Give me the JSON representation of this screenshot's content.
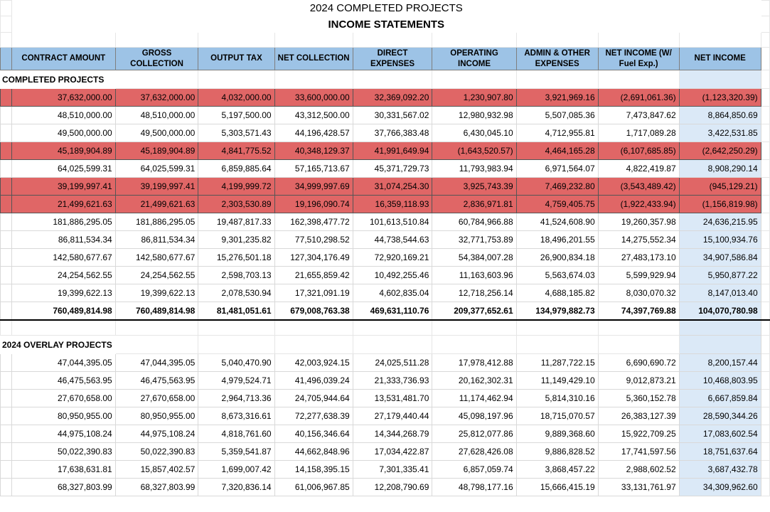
{
  "sheet": {
    "title": "2024 COMPLETED PROJECTS",
    "subtitle": "INCOME STATEMENTS"
  },
  "headers": [
    "CONTRACT AMOUNT",
    "GROSS COLLECTION",
    "OUTPUT TAX",
    "NET COLLECTION",
    "DIRECT EXPENSES",
    "OPERATING INCOME",
    "ADMIN & OTHER EXPENSES",
    "NET INCOME (W/ Fuel Exp.)",
    "NET INCOME"
  ],
  "completed": {
    "label": "COMPLETED PROJECTS",
    "rows": [
      {
        "highlight": true,
        "cells": [
          "37,632,000.00",
          "37,632,000.00",
          "4,032,000.00",
          "33,600,000.00",
          "32,369,092.20",
          "1,230,907.80",
          "3,921,969.16",
          "(2,691,061.36)",
          "(1,123,320.39)"
        ]
      },
      {
        "highlight": false,
        "cells": [
          "48,510,000.00",
          "48,510,000.00",
          "5,197,500.00",
          "43,312,500.00",
          "30,331,567.02",
          "12,980,932.98",
          "5,507,085.36",
          "7,473,847.62",
          "8,864,850.69"
        ]
      },
      {
        "highlight": false,
        "cells": [
          "49,500,000.00",
          "49,500,000.00",
          "5,303,571.43",
          "44,196,428.57",
          "37,766,383.48",
          "6,430,045.10",
          "4,712,955.81",
          "1,717,089.28",
          "3,422,531.85"
        ]
      },
      {
        "highlight": true,
        "cells": [
          "45,189,904.89",
          "45,189,904.89",
          "4,841,775.52",
          "40,348,129.37",
          "41,991,649.94",
          "(1,643,520.57)",
          "4,464,165.28",
          "(6,107,685.85)",
          "(2,642,250.29)"
        ]
      },
      {
        "highlight": false,
        "cells": [
          "64,025,599.31",
          "64,025,599.31",
          "6,859,885.64",
          "57,165,713.67",
          "45,371,729.73",
          "11,793,983.94",
          "6,971,564.07",
          "4,822,419.87",
          "8,908,290.14"
        ]
      },
      {
        "highlight": true,
        "cells": [
          "39,199,997.41",
          "39,199,997.41",
          "4,199,999.72",
          "34,999,997.69",
          "31,074,254.30",
          "3,925,743.39",
          "7,469,232.80",
          "(3,543,489.42)",
          "(945,129.21)"
        ]
      },
      {
        "highlight": true,
        "cells": [
          "21,499,621.63",
          "21,499,621.63",
          "2,303,530.89",
          "19,196,090.74",
          "16,359,118.93",
          "2,836,971.81",
          "4,759,405.75",
          "(1,922,433.94)",
          "(1,156,819.98)"
        ]
      },
      {
        "highlight": false,
        "cells": [
          "181,886,295.05",
          "181,886,295.05",
          "19,487,817.33",
          "162,398,477.72",
          "101,613,510.84",
          "60,784,966.88",
          "41,524,608.90",
          "19,260,357.98",
          "24,636,215.95"
        ]
      },
      {
        "highlight": false,
        "cells": [
          "86,811,534.34",
          "86,811,534.34",
          "9,301,235.82",
          "77,510,298.52",
          "44,738,544.63",
          "32,771,753.89",
          "18,496,201.55",
          "14,275,552.34",
          "15,100,934.76"
        ]
      },
      {
        "highlight": false,
        "cells": [
          "142,580,677.67",
          "142,580,677.67",
          "15,276,501.18",
          "127,304,176.49",
          "72,920,169.21",
          "54,384,007.28",
          "26,900,834.18",
          "27,483,173.10",
          "34,907,586.84"
        ]
      },
      {
        "highlight": false,
        "cells": [
          "24,254,562.55",
          "24,254,562.55",
          "2,598,703.13",
          "21,655,859.42",
          "10,492,255.46",
          "11,163,603.96",
          "5,563,674.03",
          "5,599,929.94",
          "5,950,877.22"
        ]
      },
      {
        "highlight": false,
        "cells": [
          "19,399,622.13",
          "19,399,622.13",
          "2,078,530.94",
          "17,321,091.19",
          "4,602,835.04",
          "12,718,256.14",
          "4,688,185.82",
          "8,030,070.32",
          "8,147,013.40"
        ]
      }
    ],
    "total": [
      "760,489,814.98",
      "760,489,814.98",
      "81,481,051.61",
      "679,008,763.38",
      "469,631,110.76",
      "209,377,652.61",
      "134,979,882.73",
      "74,397,769.88",
      "104,070,780.98"
    ]
  },
  "overlay": {
    "label": "2024 OVERLAY PROJECTS",
    "rows": [
      {
        "highlight": false,
        "cells": [
          "47,044,395.05",
          "47,044,395.05",
          "5,040,470.90",
          "42,003,924.15",
          "24,025,511.28",
          "17,978,412.88",
          "11,287,722.15",
          "6,690,690.72",
          "8,200,157.44"
        ]
      },
      {
        "highlight": false,
        "cells": [
          "46,475,563.95",
          "46,475,563.95",
          "4,979,524.71",
          "41,496,039.24",
          "21,333,736.93",
          "20,162,302.31",
          "11,149,429.10",
          "9,012,873.21",
          "10,468,803.95"
        ]
      },
      {
        "highlight": false,
        "cells": [
          "27,670,658.00",
          "27,670,658.00",
          "2,964,713.36",
          "24,705,944.64",
          "13,531,481.70",
          "11,174,462.94",
          "5,814,310.16",
          "5,360,152.78",
          "6,667,859.84"
        ]
      },
      {
        "highlight": false,
        "cells": [
          "80,950,955.00",
          "80,950,955.00",
          "8,673,316.61",
          "72,277,638.39",
          "27,179,440.44",
          "45,098,197.96",
          "18,715,070.57",
          "26,383,127.39",
          "28,590,344.26"
        ]
      },
      {
        "highlight": false,
        "cells": [
          "44,975,108.24",
          "44,975,108.24",
          "4,818,761.60",
          "40,156,346.64",
          "14,344,268.79",
          "25,812,077.86",
          "9,889,368.60",
          "15,922,709.25",
          "17,083,602.54"
        ]
      },
      {
        "highlight": false,
        "cells": [
          "50,022,390.83",
          "50,022,390.83",
          "5,359,541.87",
          "44,662,848.96",
          "17,034,422.87",
          "27,628,426.08",
          "9,886,828.52",
          "17,741,597.56",
          "18,751,637.64"
        ]
      },
      {
        "highlight": false,
        "cells": [
          "17,638,631.81",
          "15,857,402.57",
          "1,699,007.42",
          "14,158,395.15",
          "7,301,335.41",
          "6,857,059.74",
          "3,868,457.22",
          "2,988,602.52",
          "3,687,432.78"
        ]
      },
      {
        "highlight": false,
        "cells": [
          "68,327,803.99",
          "68,327,803.99",
          "7,320,836.14",
          "61,006,967.85",
          "12,208,790.69",
          "48,798,177.16",
          "15,666,415.19",
          "33,131,761.97",
          "34,309,962.60"
        ]
      }
    ]
  }
}
